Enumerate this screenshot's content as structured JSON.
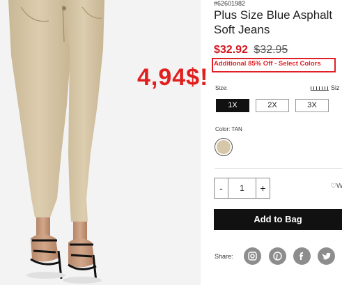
{
  "product": {
    "sku": "#62601982",
    "title_line1": "Plus Size Blue Asphalt",
    "title_line2": "Soft Jeans",
    "sale_price": "$32.92",
    "original_price": "$32.95",
    "promo": "Additional 85% Off - Select Colors",
    "overlay_price": "4,94$!"
  },
  "size": {
    "label": "Size:",
    "guide_label": "Siz",
    "options": [
      "1X",
      "2X",
      "3X"
    ],
    "selected": "1X"
  },
  "color": {
    "label": "Color: TAN",
    "swatch_hex": "#d6c7a9"
  },
  "quantity": {
    "minus": "-",
    "value": "1",
    "plus": "+"
  },
  "wishlist": {
    "icon": "heart-icon",
    "label": "W"
  },
  "cart": {
    "add_label": "Add to Bag"
  },
  "share": {
    "label": "Share:",
    "icons": [
      "instagram-icon",
      "pinterest-icon",
      "facebook-icon",
      "twitter-icon"
    ]
  },
  "colors": {
    "accent_red": "#e01f26",
    "button_black": "#111111",
    "pants_tan": "#d8c8a8"
  }
}
